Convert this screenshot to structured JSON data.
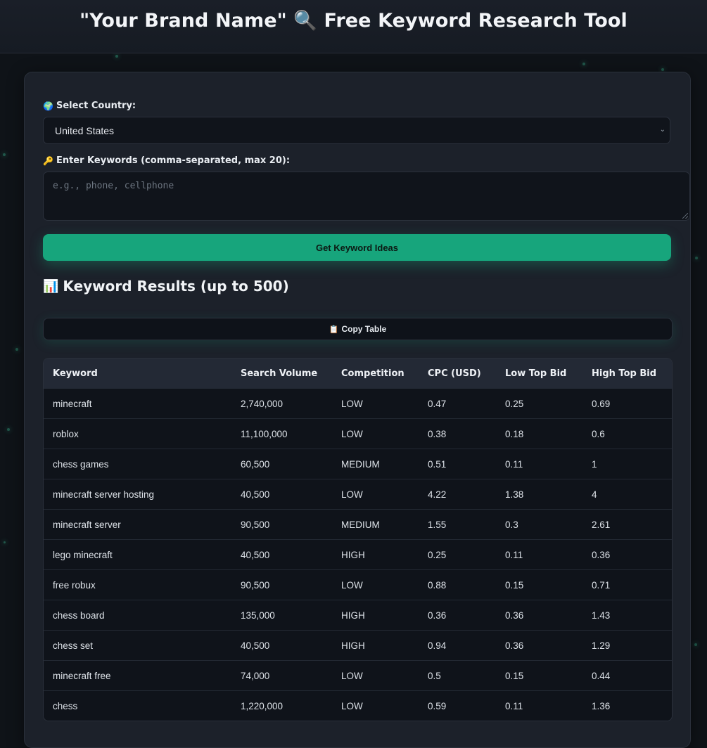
{
  "header": {
    "title": "\"Your Brand Name\" 🔍 Free Keyword Research Tool"
  },
  "form": {
    "country_label": "Select Country:",
    "country_icon": "🌍",
    "country_value": "United States",
    "keywords_label": "Enter Keywords (comma-separated, max 20):",
    "keywords_icon": "🔑",
    "keywords_placeholder": "e.g., phone, cellphone",
    "submit_label": "Get Keyword Ideas"
  },
  "results": {
    "heading": "Keyword Results (up to 500)",
    "heading_icon": "📊",
    "copy_label": "Copy Table",
    "copy_icon": "📋",
    "columns": [
      "Keyword",
      "Search Volume",
      "Competition",
      "CPC (USD)",
      "Low Top Bid",
      "High Top Bid"
    ],
    "rows": [
      [
        "minecraft",
        "2,740,000",
        "LOW",
        "0.47",
        "0.25",
        "0.69"
      ],
      [
        "roblox",
        "11,100,000",
        "LOW",
        "0.38",
        "0.18",
        "0.6"
      ],
      [
        "chess games",
        "60,500",
        "MEDIUM",
        "0.51",
        "0.11",
        "1"
      ],
      [
        "minecraft server hosting",
        "40,500",
        "LOW",
        "4.22",
        "1.38",
        "4"
      ],
      [
        "minecraft server",
        "90,500",
        "MEDIUM",
        "1.55",
        "0.3",
        "2.61"
      ],
      [
        "lego minecraft",
        "40,500",
        "HIGH",
        "0.25",
        "0.11",
        "0.36"
      ],
      [
        "free robux",
        "90,500",
        "LOW",
        "0.88",
        "0.15",
        "0.71"
      ],
      [
        "chess board",
        "135,000",
        "HIGH",
        "0.36",
        "0.36",
        "1.43"
      ],
      [
        "chess set",
        "40,500",
        "HIGH",
        "0.94",
        "0.36",
        "1.29"
      ],
      [
        "minecraft free",
        "74,000",
        "LOW",
        "0.5",
        "0.15",
        "0.44"
      ],
      [
        "chess",
        "1,220,000",
        "LOW",
        "0.59",
        "0.11",
        "1.36"
      ]
    ]
  },
  "colors": {
    "accent": "#17a57c",
    "background": "#0f1318",
    "card": "#1c212a"
  }
}
